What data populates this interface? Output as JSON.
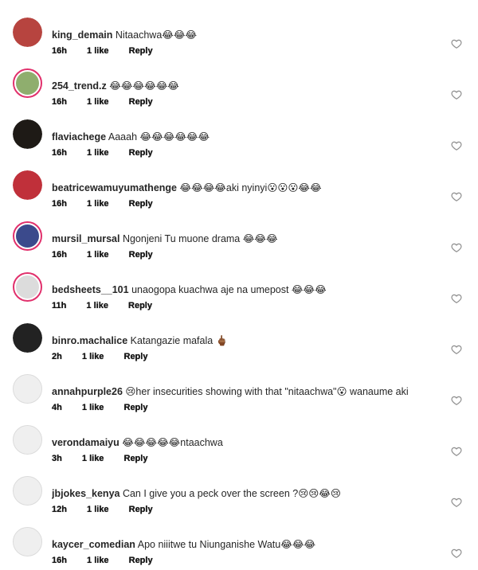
{
  "comments": [
    {
      "username": "king_demain",
      "text": "Nitaachwa😂😂😂",
      "time": "16h",
      "likes": "1 like",
      "reply": "Reply",
      "avatar_color": "#b7443f",
      "ring": false
    },
    {
      "username": "254_trend.z",
      "text": "😂😂😂😂😂😂",
      "time": "16h",
      "likes": "1 like",
      "reply": "Reply",
      "avatar_color": "#8fae6e",
      "ring": true
    },
    {
      "username": "flaviachege",
      "text": "Aaaah 😂😂😂😂😂😂",
      "time": "16h",
      "likes": "1 like",
      "reply": "Reply",
      "avatar_color": "#1e1a16",
      "ring": false
    },
    {
      "username": "beatricewamuyumathenge",
      "text": "😂😂😂😂aki nyinyi😮😮😮😂😂",
      "time": "16h",
      "likes": "1 like",
      "reply": "Reply",
      "avatar_color": "#c0303a",
      "ring": false
    },
    {
      "username": "mursil_mursal",
      "text": "Ngonjeni Tu muone drama 😂😂😂",
      "time": "16h",
      "likes": "1 like",
      "reply": "Reply",
      "avatar_color": "#3b4a8c",
      "ring": true
    },
    {
      "username": "bedsheets__101",
      "text": "unaogopa kuachwa aje na umepost 😂😂😂",
      "time": "11h",
      "likes": "1 like",
      "reply": "Reply",
      "avatar_color": "#dcdcdc",
      "ring": true
    },
    {
      "username": "binro.machalice",
      "text": "Katangazie mafala 🖕🏾",
      "time": "2h",
      "likes": "1 like",
      "reply": "Reply",
      "avatar_color": "#222222",
      "ring": false
    },
    {
      "username": "annahpurple26",
      "text": "😢her insecurities showing with that \"nitaachwa\"😮 wanaume aki",
      "time": "4h",
      "likes": "1 like",
      "reply": "Reply",
      "avatar_color": "#efefef",
      "ring": false
    },
    {
      "username": "verondamaiyu",
      "text": "😂😂😂😂😂ntaachwa",
      "time": "3h",
      "likes": "1 like",
      "reply": "Reply",
      "avatar_color": "#efefef",
      "ring": false
    },
    {
      "username": "jbjokes_kenya",
      "text": "Can I give you a peck over the screen ?😢😢😂😢",
      "time": "12h",
      "likes": "1 like",
      "reply": "Reply",
      "avatar_color": "#efefef",
      "ring": false
    },
    {
      "username": "kaycer_comedian",
      "text": "Apo niiitwe tu Niunganishe Watu😂😂😂",
      "time": "16h",
      "likes": "1 like",
      "reply": "Reply",
      "avatar_color": "#efefef",
      "ring": false
    }
  ],
  "icons": {
    "like": "heart-outline-icon"
  },
  "colors": {
    "text": "#262626",
    "heart_stroke": "#8e8e8e",
    "story_ring": "#e1306c"
  }
}
